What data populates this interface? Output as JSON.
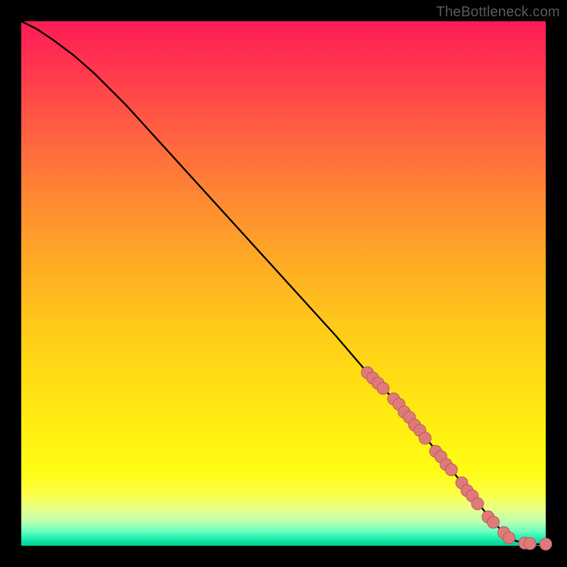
{
  "watermark": "TheBottleneck.com",
  "colors": {
    "marker_fill": "#e07a7a",
    "marker_stroke": "#b45a5a",
    "line": "#000000",
    "background_frame": "#000000"
  },
  "chart_data": {
    "type": "line",
    "title": "",
    "xlabel": "",
    "ylabel": "",
    "xlim": [
      0,
      100
    ],
    "ylim": [
      0,
      100
    ],
    "grid": false,
    "series": [
      {
        "name": "curve",
        "x": [
          0,
          3,
          6,
          10,
          14,
          20,
          30,
          40,
          50,
          60,
          66,
          68,
          70,
          72,
          74,
          76,
          78,
          80,
          82,
          84,
          86,
          88,
          90,
          92,
          94,
          96,
          98,
          100
        ],
        "y": [
          100,
          98.5,
          96.5,
          93.5,
          90,
          84,
          73,
          62,
          51,
          40,
          33,
          31,
          29,
          27,
          24.5,
          22,
          19.5,
          17,
          14.5,
          12,
          9.5,
          7,
          4.5,
          2.5,
          1,
          0.5,
          0.3,
          0.3
        ]
      }
    ],
    "markers": {
      "name": "highlighted-points",
      "points": [
        {
          "x": 66,
          "y": 33
        },
        {
          "x": 67,
          "y": 32
        },
        {
          "x": 68,
          "y": 31
        },
        {
          "x": 69,
          "y": 30
        },
        {
          "x": 71,
          "y": 28
        },
        {
          "x": 72,
          "y": 27
        },
        {
          "x": 73,
          "y": 25.5
        },
        {
          "x": 74,
          "y": 24.5
        },
        {
          "x": 75,
          "y": 23
        },
        {
          "x": 76,
          "y": 22
        },
        {
          "x": 77,
          "y": 20.5
        },
        {
          "x": 79,
          "y": 18
        },
        {
          "x": 80,
          "y": 17
        },
        {
          "x": 81,
          "y": 15.5
        },
        {
          "x": 82,
          "y": 14.5
        },
        {
          "x": 84,
          "y": 12
        },
        {
          "x": 85,
          "y": 10.5
        },
        {
          "x": 86,
          "y": 9.5
        },
        {
          "x": 87,
          "y": 8
        },
        {
          "x": 89,
          "y": 5.5
        },
        {
          "x": 90,
          "y": 4.5
        },
        {
          "x": 92,
          "y": 2.5
        },
        {
          "x": 93,
          "y": 1.5
        },
        {
          "x": 96,
          "y": 0.5
        },
        {
          "x": 97,
          "y": 0.4
        },
        {
          "x": 100,
          "y": 0.3
        }
      ]
    }
  }
}
